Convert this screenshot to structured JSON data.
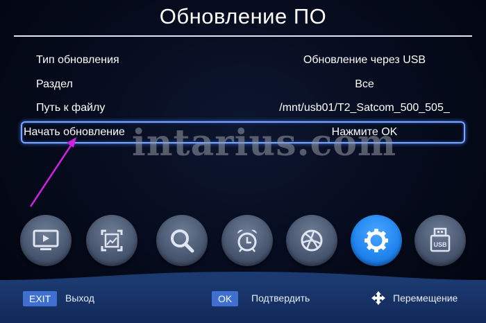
{
  "title": "Обновление ПО",
  "rows": [
    {
      "label": "Тип обновления",
      "value": "Обновление через USB"
    },
    {
      "label": "Раздел",
      "value": "Все"
    },
    {
      "label": "Путь к файлу",
      "value": "/mnt/usb01/T2_Satcom_500_505_"
    },
    {
      "label": "Начать обновление",
      "value": "Нажмите OK"
    }
  ],
  "watermark": "intarius.com",
  "menu_icons": [
    {
      "name": "tv-icon",
      "active": false
    },
    {
      "name": "picture-icon",
      "active": false
    },
    {
      "name": "search-icon",
      "active": false
    },
    {
      "name": "alarm-clock-icon",
      "active": false
    },
    {
      "name": "globe-icon",
      "active": false
    },
    {
      "name": "gear-icon",
      "active": true
    },
    {
      "name": "usb-icon",
      "active": false
    }
  ],
  "footer": {
    "exit_key": "EXIT",
    "exit_label": "Выход",
    "ok_key": "OK",
    "ok_label": "Подтвердить",
    "move_label": "Перемещение"
  },
  "colors": {
    "accent": "#2a8cf5",
    "selection_border": "#7aa8ff",
    "annotation_arrow": "#d020e0",
    "footer_bg": "#1b3a70"
  }
}
